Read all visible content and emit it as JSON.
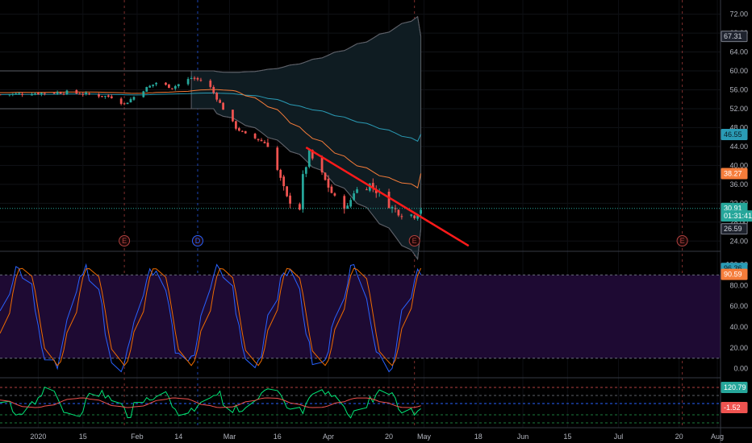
{
  "chart_data": [
    {
      "type": "candlestick",
      "panel": "price",
      "price_axis": {
        "ticks": [
          "72.00",
          "68.00",
          "64.00",
          "60.00",
          "56.00",
          "52.00",
          "48.00",
          "44.00",
          "40.00",
          "36.00",
          "32.00",
          "28.00",
          "24.00"
        ],
        "range": [
          22,
          75
        ]
      },
      "x_axis": {
        "date_ticks": [
          "2020",
          "15",
          "Feb",
          "14",
          "Mar",
          "16",
          "Apr",
          "20",
          "May",
          "18",
          "Jun",
          "15",
          "Jul",
          "20",
          "Aug"
        ],
        "date_positions": [
          "2020-01-01",
          "2020-01-15",
          "2020-02-01",
          "2020-02-14",
          "2020-03-01",
          "2020-03-16",
          "2020-04-01",
          "2020-04-20",
          "2020-05-01",
          "2020-05-18",
          "2020-06-01",
          "2020-06-15",
          "2020-07-01",
          "2020-07-20",
          "2020-08-01"
        ],
        "range": [
          "2019-12-20",
          "2020-08-02"
        ]
      },
      "price_tags": [
        {
          "text": "67.31",
          "value": 67.31,
          "bg": "#1e222d",
          "fg": "#d1d4dc",
          "border": "#787b86"
        },
        {
          "text": "46.55",
          "value": 46.55,
          "bg": "#2a9bb5",
          "fg": "#0b1a22",
          "border": "#2a9bb5"
        },
        {
          "text": "38.27",
          "value": 38.27,
          "bg": "#f57c3a",
          "fg": "#ffffff",
          "border": "#f57c3a"
        },
        {
          "text": "30.91",
          "value": 30.91,
          "bg": "#26a69a",
          "fg": "#ffffff",
          "border": "#26a69a"
        },
        {
          "text": "01:31:41",
          "value": 29.3,
          "bg": "#26a69a",
          "fg": "#ffffff",
          "border": "#26a69a"
        },
        {
          "text": "26.59",
          "value": 26.59,
          "bg": "#1e222d",
          "fg": "#d1d4dc",
          "border": "#787b86"
        }
      ],
      "earnings_markers": [
        {
          "label": "E",
          "date": "2020-01-28",
          "color": "#b2413f"
        },
        {
          "label": "D",
          "date": "2020-02-20",
          "color": "#2962ff"
        },
        {
          "label": "E",
          "date": "2020-04-28",
          "color": "#b2413f"
        },
        {
          "label": "E",
          "date": "2020-07-21",
          "color": "#b2413f"
        }
      ],
      "current_price": 30.91,
      "trendline": {
        "start": [
          "2020-03-25",
          43.8
        ],
        "end": [
          "2020-05-15",
          23.0
        ],
        "color": "#ff1a1a"
      },
      "projection": {
        "start": "2020-04-30",
        "upper": 67.3,
        "mid_teal": 46.6,
        "mid_orange": 38.3,
        "lower": 26.6
      },
      "colors": {
        "up": "#26a69a",
        "down": "#ef5350",
        "ma_orange": "#f57c3a",
        "ma_teal": "#2a9bb5",
        "band": "#787b86",
        "background": "#000000"
      }
    },
    {
      "type": "line",
      "panel": "stochastic",
      "y_ticks": [
        "100.00",
        "80.00",
        "60.00",
        "40.00",
        "20.00",
        "0.00"
      ],
      "range": [
        -8,
        112
      ],
      "band": [
        10,
        90
      ],
      "series": [
        {
          "color": "#2962ff"
        },
        {
          "color": "#ef6c00"
        }
      ],
      "value_tags": [
        {
          "text": "96.36",
          "value": 96.36,
          "bg": "#2a9bb5",
          "fg": "#0b1a22"
        },
        {
          "text": "90.59",
          "value": 90.59,
          "bg": "#f57c3a",
          "fg": "#ffffff"
        }
      ]
    },
    {
      "type": "line",
      "panel": "cci",
      "y_ticks": [],
      "value_tags": [
        {
          "text": "120.79",
          "value": 120.79,
          "bg": "#26a69a",
          "fg": "#ffffff"
        },
        {
          "text": "-1.52",
          "value": -1.52,
          "bg": "#ef5350",
          "fg": "#ffffff"
        }
      ],
      "series": [
        {
          "color": "#00e676"
        },
        {
          "color": "#ef5350"
        }
      ]
    }
  ]
}
